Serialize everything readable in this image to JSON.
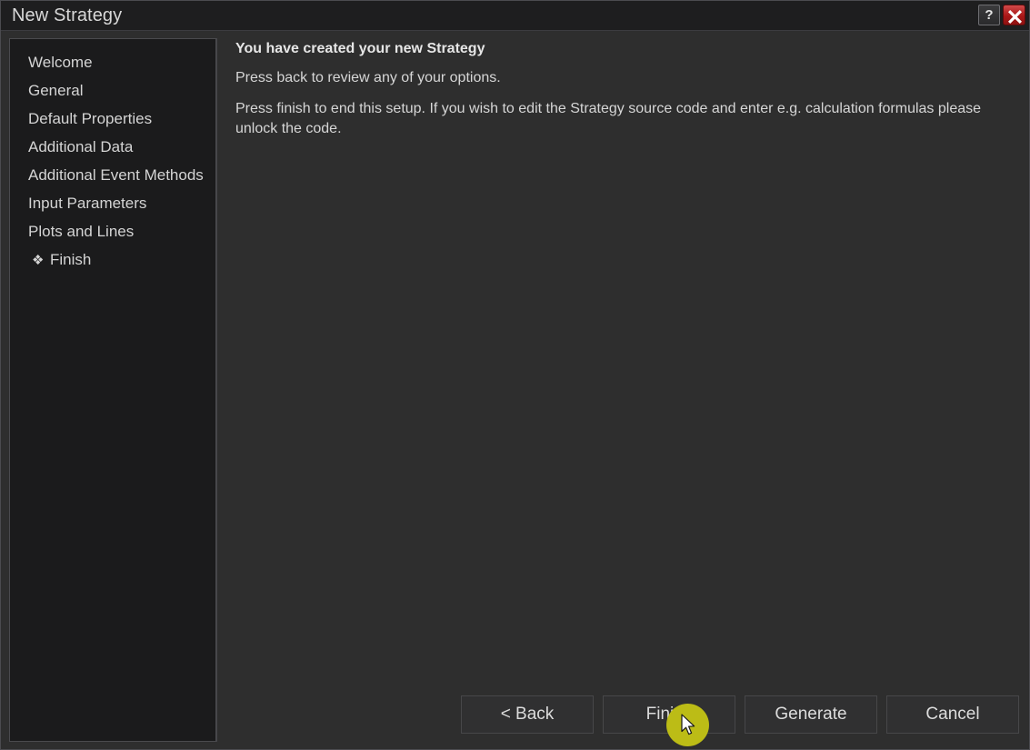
{
  "window": {
    "title": "New Strategy",
    "help_button": "?",
    "close_button": "✖"
  },
  "sidebar": {
    "items": [
      {
        "label": "Welcome",
        "current": false,
        "marker": ""
      },
      {
        "label": "General",
        "current": false,
        "marker": ""
      },
      {
        "label": "Default Properties",
        "current": false,
        "marker": ""
      },
      {
        "label": "Additional Data",
        "current": false,
        "marker": ""
      },
      {
        "label": "Additional Event Methods",
        "current": false,
        "marker": ""
      },
      {
        "label": "Input Parameters",
        "current": false,
        "marker": ""
      },
      {
        "label": "Plots and Lines",
        "current": false,
        "marker": ""
      },
      {
        "label": "Finish",
        "current": true,
        "marker": "❖"
      }
    ]
  },
  "main": {
    "heading": "You have created your new Strategy",
    "paragraph1": "Press back to review any of your options.",
    "paragraph2": "Press finish to end this setup. If you wish to edit the Strategy source code and enter e.g. calculation formulas please unlock the code."
  },
  "footer": {
    "buttons": [
      {
        "label": "< Back"
      },
      {
        "label": "Finish"
      },
      {
        "label": "Generate"
      },
      {
        "label": "Cancel"
      }
    ]
  },
  "colors": {
    "window_bg": "#2e2e2e",
    "titlebar_bg": "#1e1e1f",
    "sidebar_bg": "#1b1b1c",
    "text": "#d6d6d6",
    "close_red": "#a81717",
    "click_highlight": "#bcbc16"
  }
}
